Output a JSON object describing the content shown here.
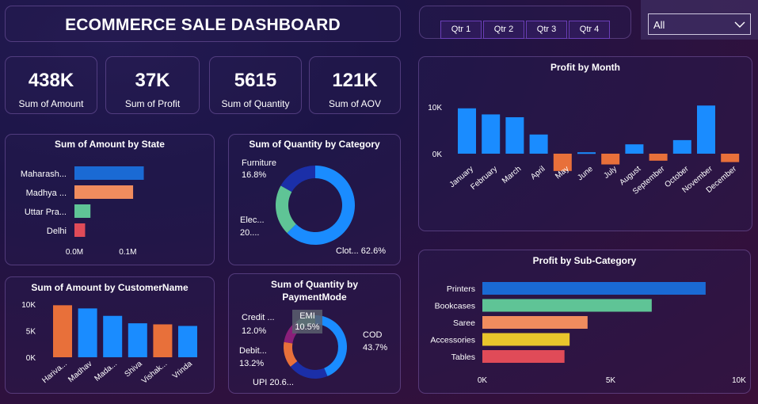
{
  "title": "ECOMMERCE SALE DASHBOARD",
  "quarters": [
    "Qtr 1",
    "Qtr 2",
    "Qtr 3",
    "Qtr 4"
  ],
  "filter": {
    "selected": "All"
  },
  "kpis": [
    {
      "value": "438K",
      "label": "Sum of Amount"
    },
    {
      "value": "37K",
      "label": "Sum of Profit"
    },
    {
      "value": "5615",
      "label": "Sum of Quantity"
    },
    {
      "value": "121K",
      "label": "Sum of AOV"
    }
  ],
  "colors": {
    "blue": "#1a8cff",
    "orange": "#e8703a",
    "green": "#5fc496",
    "red": "#e04b58",
    "navy": "#1b2fa8",
    "purple": "#8a1f7a"
  },
  "chart_data": [
    {
      "id": "state",
      "type": "bar",
      "title": "Sum of Amount by State",
      "orientation": "horizontal",
      "categories": [
        "Maharash...",
        "Madhya ...",
        "Uttar Pra...",
        "Delhi"
      ],
      "values": [
        0.13,
        0.11,
        0.03,
        0.02
      ],
      "colors": [
        "#1a6ad4",
        "#f08c5e",
        "#5fc496",
        "#e04b58"
      ],
      "xticks": [
        "0.0M",
        "0.1M"
      ],
      "xlim": [
        0,
        0.15
      ]
    },
    {
      "id": "category",
      "type": "pie",
      "title": "Sum of Quantity by Category",
      "labels": [
        "Clot... 62.6%",
        "Elec... 20....",
        "Furniture 16.8%"
      ],
      "values": [
        62.6,
        20.6,
        16.8
      ],
      "colors": [
        "#1a8cff",
        "#5fc496",
        "#1b2fa8"
      ]
    },
    {
      "id": "customer",
      "type": "bar",
      "title": "Sum of Amount by CustomerName",
      "categories": [
        "Hariva...",
        "Madhav",
        "Mada...",
        "Shiva",
        "Vishak...",
        "Vrinda"
      ],
      "values": [
        9800,
        9200,
        7800,
        6400,
        6200,
        5900
      ],
      "colors": [
        "#e8703a",
        "#1a8cff",
        "#1a8cff",
        "#1a8cff",
        "#e8703a",
        "#1a8cff"
      ],
      "yticks": [
        "10K",
        "5K",
        "0K"
      ],
      "ylim": [
        0,
        10000
      ]
    },
    {
      "id": "payment",
      "type": "pie",
      "title": "Sum of Quantity by PaymentMode",
      "labels": [
        "COD 43.7%",
        "UPI 20.6...",
        "Debit... 13.2%",
        "Credit ... 12.0%",
        "EMI 10.5%"
      ],
      "values": [
        43.7,
        20.6,
        13.2,
        12.0,
        10.5
      ],
      "colors": [
        "#1a8cff",
        "#1b2fa8",
        "#e8703a",
        "#8a1f7a",
        "#5fc496"
      ]
    },
    {
      "id": "month",
      "type": "bar",
      "title": "Profit by Month",
      "categories": [
        "January",
        "February",
        "March",
        "April",
        "May",
        "June",
        "July",
        "August",
        "September",
        "October",
        "November",
        "December"
      ],
      "values": [
        9700,
        8400,
        7800,
        4100,
        -3700,
        300,
        -2300,
        2000,
        -1500,
        2900,
        10300,
        -1800
      ],
      "yticks": [
        "10K",
        "0K"
      ],
      "ylim": [
        -5000,
        12000
      ]
    },
    {
      "id": "subcategory",
      "type": "bar",
      "title": "Profit by Sub-Category",
      "orientation": "horizontal",
      "categories": [
        "Printers",
        "Bookcases",
        "Saree",
        "Accessories",
        "Tables"
      ],
      "values": [
        8700,
        6600,
        4100,
        3400,
        3200
      ],
      "colors": [
        "#1a6ad4",
        "#5fc496",
        "#f08c5e",
        "#e8c52c",
        "#e04b58"
      ],
      "xticks": [
        "0K",
        "5K",
        "10K"
      ],
      "xlim": [
        0,
        10000
      ]
    }
  ]
}
